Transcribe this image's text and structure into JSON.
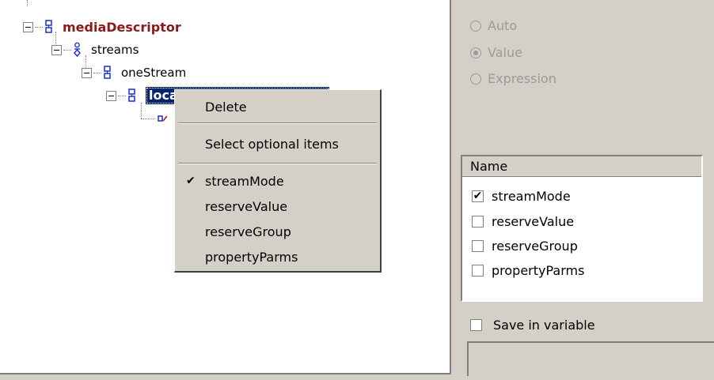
{
  "tree": {
    "nodes": [
      {
        "label": "mediaDescriptor"
      },
      {
        "label": "streams"
      },
      {
        "label": "oneStream"
      },
      {
        "label": "localStreamInfo"
      }
    ]
  },
  "radio_group": {
    "options": [
      {
        "label": "Auto",
        "selected": false
      },
      {
        "label": "Value",
        "selected": true
      },
      {
        "label": "Expression",
        "selected": false
      }
    ]
  },
  "list": {
    "header": "Name",
    "items": [
      {
        "label": "streamMode",
        "checked": true
      },
      {
        "label": "reserveValue",
        "checked": false
      },
      {
        "label": "reserveGroup",
        "checked": false
      },
      {
        "label": "propertyParms",
        "checked": false
      }
    ]
  },
  "save_in_variable": {
    "label": "Save in variable",
    "checked": false
  },
  "context_menu": {
    "delete": "Delete",
    "select_optional": "Select optional items",
    "items": [
      {
        "label": "streamMode",
        "checked": true
      },
      {
        "label": "reserveValue",
        "checked": false
      },
      {
        "label": "reserveGroup",
        "checked": false
      },
      {
        "label": "propertyParms",
        "checked": false
      }
    ]
  },
  "colors": {
    "root_label": "#8b1a1a",
    "icon_blue": "#1a2fd0",
    "selection": "#0a246a"
  }
}
